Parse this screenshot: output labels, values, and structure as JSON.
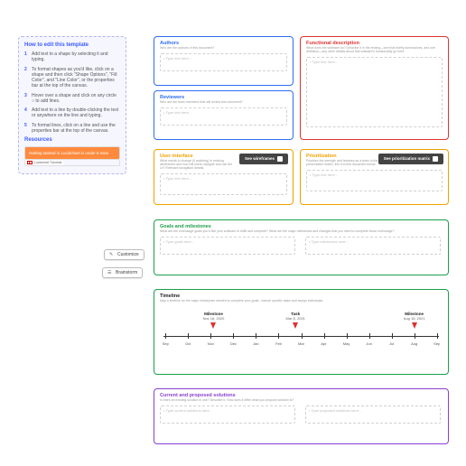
{
  "help": {
    "title": "How to edit this template",
    "steps": [
      "Add text to a shape by selecting it and typing.",
      "To format shapes as you'd like, click on a shape and then click \"Shape Options\", \"Fill Color\", and \"Line Color\", or the properties bar at the top of the canvas.",
      "Hover over a shape and click on any circle ○ to add lines.",
      "Add text to a line by double-clicking the text or anywhere on the line and typing.",
      "To format lines, click on a line and use the properties bar at the top of the canvas."
    ],
    "resources_title": "Resources",
    "video": {
      "headline": "Getting started in Lucidchart in under 5 mins",
      "caption": "Lucidchart Tutorials"
    }
  },
  "buttons": {
    "customize": "Customize",
    "brainstorm": "Brainstorm"
  },
  "cards": {
    "authors": {
      "title": "Authors",
      "sub": "Who are the authors of this document?",
      "placeholder": "• Type text here..."
    },
    "reviewers": {
      "title": "Reviewers",
      "sub": "Who are the team members that will review this document?",
      "placeholder": "• Type text here..."
    },
    "funcdesc": {
      "title": "Functional description",
      "sub": "What does the software do? Describe it in the ending—one that briefly summarizes, and one definition—any other details about this software's functionality go here.",
      "placeholder": "• Type text here..."
    },
    "ui": {
      "title": "User interface",
      "sub": "What needs to change (if anything) in existing wireframes and how will users navigate and use the UI? Relevant navigation details.",
      "placeholder": "• Type text here...",
      "cta": "See wireframes"
    },
    "prio": {
      "title": "Prioritization",
      "sub": "Prioritize the strength and features as a team in the presentation matrix; link it to this document below.",
      "placeholder": "• Type text here...",
      "cta": "See prioritization matrix"
    },
    "goals": {
      "title": "Goals and milestones",
      "sub": "What are the end/usage goals you'd like your software to fulfill and complete? What are the major milestones and changes that you need to complete those end/usage?",
      "ph1": "• Type goals here...",
      "ph2": "• Type milestones here..."
    },
    "timeline": {
      "title": "Timeline",
      "sub": "Map a timeline for the major milestones needed to complete your goals. Include specific tasks and assign individuals."
    },
    "solutions": {
      "title": "Current and proposed solutions",
      "sub": "Is there an existing solution in use? Describe it. How does it differ what you propose solution is?",
      "ph1": "• Type current solutions here...",
      "ph2": "• Type proposed solutions here..."
    }
  },
  "timeline": {
    "months": [
      "Sep",
      "Oct",
      "Nov",
      "Dec",
      "Jan",
      "Feb",
      "Mar",
      "Apr",
      "May",
      "Jun",
      "Jul",
      "Aug",
      "Sep"
    ],
    "markers": [
      {
        "title": "Milestone",
        "date": "Nov 16, 2020",
        "pos": 19
      },
      {
        "title": "Task",
        "date": "Mar 8, 2021",
        "pos": 48
      },
      {
        "title": "Milestone",
        "date": "Aug 16, 2021",
        "pos": 90
      }
    ]
  }
}
